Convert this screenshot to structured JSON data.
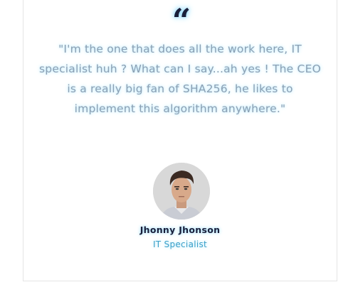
{
  "testimonial": {
    "quote_icon": "quote-mark-icon",
    "quote": "\"I'm the one that does all the work here, IT specialist huh ? What can I say...ah yes ! The CEO is a really big fan of SHA256, he likes to implement this algorithm anywhere.\"",
    "author_name": "Jhonny Jhonson",
    "author_role": "IT Specialist"
  },
  "colors": {
    "name": "#1a1f3a",
    "role": "#3aa0c8",
    "quote_text": "#8ca0b2",
    "glow": "#7fd3ff"
  }
}
